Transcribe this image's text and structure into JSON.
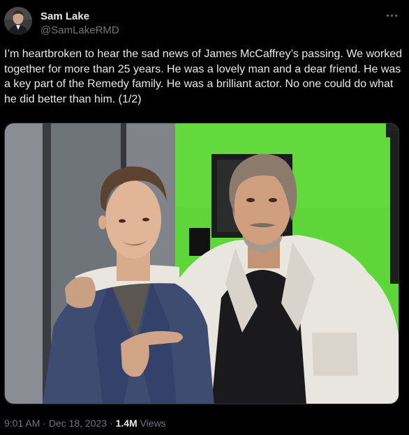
{
  "author": {
    "display_name": "Sam Lake",
    "handle": "@SamLakeRMD"
  },
  "more_icon": "more-horizontal-icon",
  "tweet": {
    "text": "I’m heartbroken to hear the sad news of James McCaffrey’s passing. We worked together for more than 25 years. He was a lovely man and a dear friend. He was a key part of the Remedy family. He was a brilliant actor. No one could do what he did better than him. (1/2)"
  },
  "meta": {
    "time": "9:01 AM",
    "separator_1": " · ",
    "date": "Dec 18, 2023",
    "separator_2": " · ",
    "views_count": "1.4M",
    "views_label": " Views"
  },
  "colors": {
    "background": "#000000",
    "text_primary": "#e7e9ea",
    "text_secondary": "#71767b",
    "green_screen": "#5ed63a"
  }
}
